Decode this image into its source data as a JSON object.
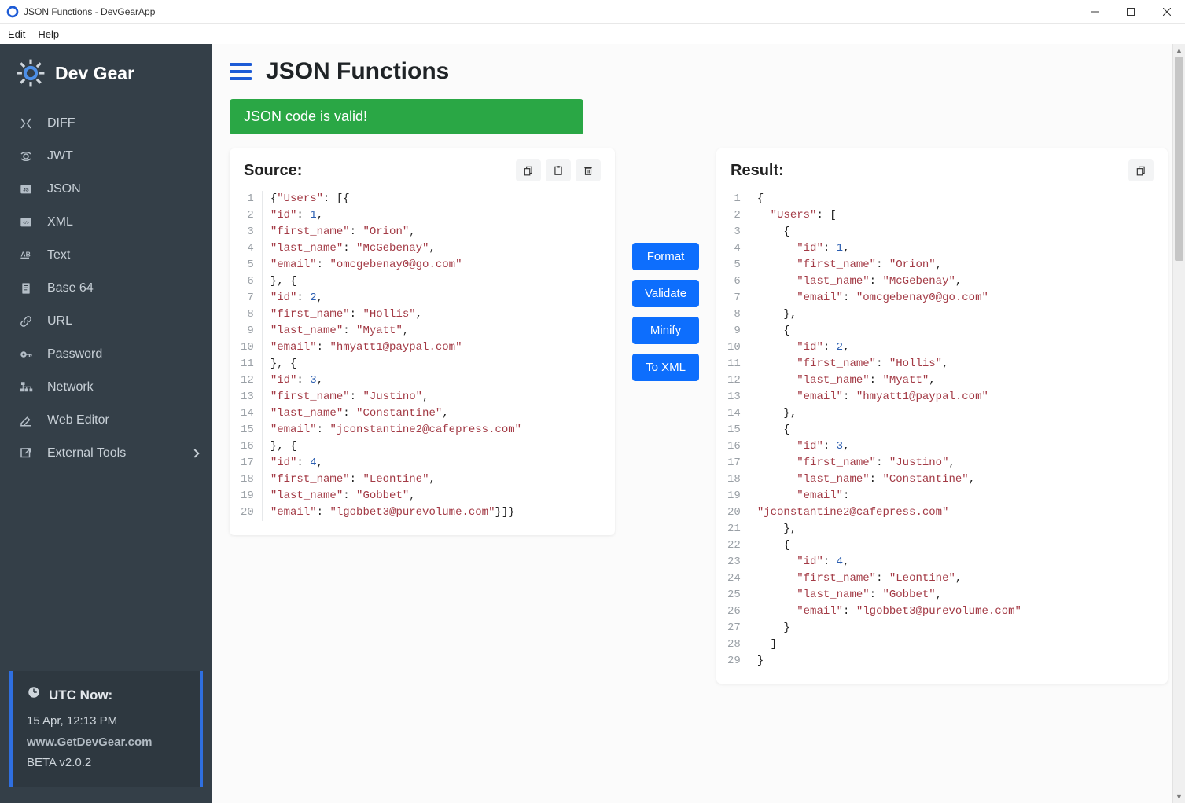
{
  "window": {
    "title": "JSON Functions - DevGearApp"
  },
  "menu": {
    "edit": "Edit",
    "help": "Help"
  },
  "brand": "Dev Gear",
  "nav": [
    {
      "label": "DIFF"
    },
    {
      "label": "JWT"
    },
    {
      "label": "JSON"
    },
    {
      "label": "XML"
    },
    {
      "label": "Text"
    },
    {
      "label": "Base 64"
    },
    {
      "label": "URL"
    },
    {
      "label": "Password"
    },
    {
      "label": "Network"
    },
    {
      "label": "Web Editor"
    },
    {
      "label": "External Tools"
    }
  ],
  "footer": {
    "utc_label": "UTC Now:",
    "time": "15 Apr, 12:13 PM",
    "site": "www.GetDevGear.com",
    "version": "BETA v2.0.2"
  },
  "page": {
    "title": "JSON Functions",
    "alert": "JSON code is valid!"
  },
  "panels": {
    "source_title": "Source:",
    "result_title": "Result:"
  },
  "actions": {
    "format": "Format",
    "validate": "Validate",
    "minify": "Minify",
    "toxml": "To XML"
  },
  "source_lines": [
    [
      [
        "p",
        "{"
      ],
      [
        "k",
        "\"Users\""
      ],
      [
        "p",
        ": [{"
      ]
    ],
    [
      [
        "k",
        "\"id\""
      ],
      [
        "p",
        ": "
      ],
      [
        "n",
        "1"
      ],
      [
        "p",
        ","
      ]
    ],
    [
      [
        "k",
        "\"first_name\""
      ],
      [
        "p",
        ": "
      ],
      [
        "k",
        "\"Orion\""
      ],
      [
        "p",
        ","
      ]
    ],
    [
      [
        "k",
        "\"last_name\""
      ],
      [
        "p",
        ": "
      ],
      [
        "k",
        "\"McGebenay\""
      ],
      [
        "p",
        ","
      ]
    ],
    [
      [
        "k",
        "\"email\""
      ],
      [
        "p",
        ": "
      ],
      [
        "k",
        "\"omcgebenay0@go.com\""
      ]
    ],
    [
      [
        "p",
        "}, {"
      ]
    ],
    [
      [
        "k",
        "\"id\""
      ],
      [
        "p",
        ": "
      ],
      [
        "n",
        "2"
      ],
      [
        "p",
        ","
      ]
    ],
    [
      [
        "k",
        "\"first_name\""
      ],
      [
        "p",
        ": "
      ],
      [
        "k",
        "\"Hollis\""
      ],
      [
        "p",
        ","
      ]
    ],
    [
      [
        "k",
        "\"last_name\""
      ],
      [
        "p",
        ": "
      ],
      [
        "k",
        "\"Myatt\""
      ],
      [
        "p",
        ","
      ]
    ],
    [
      [
        "k",
        "\"email\""
      ],
      [
        "p",
        ": "
      ],
      [
        "k",
        "\"hmyatt1@paypal.com\""
      ]
    ],
    [
      [
        "p",
        "}, {"
      ]
    ],
    [
      [
        "k",
        "\"id\""
      ],
      [
        "p",
        ": "
      ],
      [
        "n",
        "3"
      ],
      [
        "p",
        ","
      ]
    ],
    [
      [
        "k",
        "\"first_name\""
      ],
      [
        "p",
        ": "
      ],
      [
        "k",
        "\"Justino\""
      ],
      [
        "p",
        ","
      ]
    ],
    [
      [
        "k",
        "\"last_name\""
      ],
      [
        "p",
        ": "
      ],
      [
        "k",
        "\"Constantine\""
      ],
      [
        "p",
        ","
      ]
    ],
    [
      [
        "k",
        "\"email\""
      ],
      [
        "p",
        ": "
      ],
      [
        "k",
        "\"jconstantine2@cafepress.com\""
      ]
    ],
    [
      [
        "p",
        "}, {"
      ]
    ],
    [
      [
        "k",
        "\"id\""
      ],
      [
        "p",
        ": "
      ],
      [
        "n",
        "4"
      ],
      [
        "p",
        ","
      ]
    ],
    [
      [
        "k",
        "\"first_name\""
      ],
      [
        "p",
        ": "
      ],
      [
        "k",
        "\"Leontine\""
      ],
      [
        "p",
        ","
      ]
    ],
    [
      [
        "k",
        "\"last_name\""
      ],
      [
        "p",
        ": "
      ],
      [
        "k",
        "\"Gobbet\""
      ],
      [
        "p",
        ","
      ]
    ],
    [
      [
        "k",
        "\"email\""
      ],
      [
        "p",
        ": "
      ],
      [
        "k",
        "\"lgobbet3@purevolume.com\""
      ],
      [
        "p",
        "}]}"
      ]
    ]
  ],
  "result_lines": [
    [
      [
        "p",
        "{"
      ]
    ],
    [
      [
        "p",
        "  "
      ],
      [
        "k",
        "\"Users\""
      ],
      [
        "p",
        ": ["
      ]
    ],
    [
      [
        "p",
        "    {"
      ]
    ],
    [
      [
        "p",
        "      "
      ],
      [
        "k",
        "\"id\""
      ],
      [
        "p",
        ": "
      ],
      [
        "n",
        "1"
      ],
      [
        "p",
        ","
      ]
    ],
    [
      [
        "p",
        "      "
      ],
      [
        "k",
        "\"first_name\""
      ],
      [
        "p",
        ": "
      ],
      [
        "k",
        "\"Orion\""
      ],
      [
        "p",
        ","
      ]
    ],
    [
      [
        "p",
        "      "
      ],
      [
        "k",
        "\"last_name\""
      ],
      [
        "p",
        ": "
      ],
      [
        "k",
        "\"McGebenay\""
      ],
      [
        "p",
        ","
      ]
    ],
    [
      [
        "p",
        "      "
      ],
      [
        "k",
        "\"email\""
      ],
      [
        "p",
        ": "
      ],
      [
        "k",
        "\"omcgebenay0@go.com\""
      ]
    ],
    [
      [
        "p",
        "    },"
      ]
    ],
    [
      [
        "p",
        "    {"
      ]
    ],
    [
      [
        "p",
        "      "
      ],
      [
        "k",
        "\"id\""
      ],
      [
        "p",
        ": "
      ],
      [
        "n",
        "2"
      ],
      [
        "p",
        ","
      ]
    ],
    [
      [
        "p",
        "      "
      ],
      [
        "k",
        "\"first_name\""
      ],
      [
        "p",
        ": "
      ],
      [
        "k",
        "\"Hollis\""
      ],
      [
        "p",
        ","
      ]
    ],
    [
      [
        "p",
        "      "
      ],
      [
        "k",
        "\"last_name\""
      ],
      [
        "p",
        ": "
      ],
      [
        "k",
        "\"Myatt\""
      ],
      [
        "p",
        ","
      ]
    ],
    [
      [
        "p",
        "      "
      ],
      [
        "k",
        "\"email\""
      ],
      [
        "p",
        ": "
      ],
      [
        "k",
        "\"hmyatt1@paypal.com\""
      ]
    ],
    [
      [
        "p",
        "    },"
      ]
    ],
    [
      [
        "p",
        "    {"
      ]
    ],
    [
      [
        "p",
        "      "
      ],
      [
        "k",
        "\"id\""
      ],
      [
        "p",
        ": "
      ],
      [
        "n",
        "3"
      ],
      [
        "p",
        ","
      ]
    ],
    [
      [
        "p",
        "      "
      ],
      [
        "k",
        "\"first_name\""
      ],
      [
        "p",
        ": "
      ],
      [
        "k",
        "\"Justino\""
      ],
      [
        "p",
        ","
      ]
    ],
    [
      [
        "p",
        "      "
      ],
      [
        "k",
        "\"last_name\""
      ],
      [
        "p",
        ": "
      ],
      [
        "k",
        "\"Constantine\""
      ],
      [
        "p",
        ","
      ]
    ],
    [
      [
        "p",
        "      "
      ],
      [
        "k",
        "\"email\""
      ],
      [
        "p",
        ": "
      ]
    ],
    [
      [
        "k",
        "\"jconstantine2@cafepress.com\""
      ]
    ],
    [
      [
        "p",
        "    },"
      ]
    ],
    [
      [
        "p",
        "    {"
      ]
    ],
    [
      [
        "p",
        "      "
      ],
      [
        "k",
        "\"id\""
      ],
      [
        "p",
        ": "
      ],
      [
        "n",
        "4"
      ],
      [
        "p",
        ","
      ]
    ],
    [
      [
        "p",
        "      "
      ],
      [
        "k",
        "\"first_name\""
      ],
      [
        "p",
        ": "
      ],
      [
        "k",
        "\"Leontine\""
      ],
      [
        "p",
        ","
      ]
    ],
    [
      [
        "p",
        "      "
      ],
      [
        "k",
        "\"last_name\""
      ],
      [
        "p",
        ": "
      ],
      [
        "k",
        "\"Gobbet\""
      ],
      [
        "p",
        ","
      ]
    ],
    [
      [
        "p",
        "      "
      ],
      [
        "k",
        "\"email\""
      ],
      [
        "p",
        ": "
      ],
      [
        "k",
        "\"lgobbet3@purevolume.com\""
      ]
    ],
    [
      [
        "p",
        "    }"
      ]
    ],
    [
      [
        "p",
        "  ]"
      ]
    ],
    [
      [
        "p",
        "}"
      ]
    ]
  ]
}
